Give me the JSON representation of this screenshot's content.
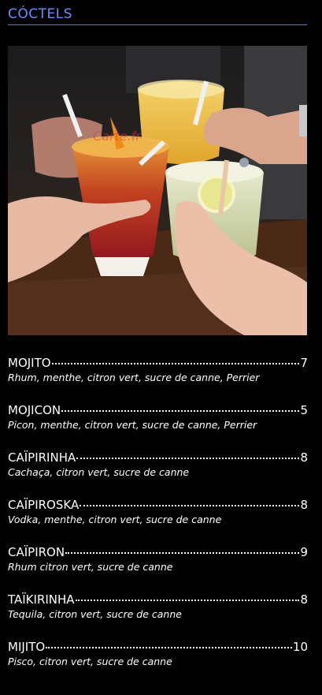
{
  "header": {
    "title": "CÓCTELS"
  },
  "photo": {
    "watermark": "Carte.fr"
  },
  "menu": {
    "items": [
      {
        "name": "MOJITO",
        "price": "7",
        "description": "Rhum, menthe, citron vert, sucre de canne, Perrier"
      },
      {
        "name": "MOJICON",
        "price": "5",
        "description": "Picon, menthe, citron vert, sucre de canne, Perrier"
      },
      {
        "name": "CAÏPIRINHA",
        "price": "8",
        "description": "Cachaça, citron vert, sucre de canne"
      },
      {
        "name": "CAÏPIROSKA",
        "price": "8",
        "description": "Vodka, menthe, citron vert, sucre de canne"
      },
      {
        "name": "CAÏPIRON",
        "price": "9",
        "description": "Rhum citron vert, sucre de canne"
      },
      {
        "name": "TAÏKIRINHA",
        "price": "8",
        "description": "Tequila, citron vert, sucre de canne"
      },
      {
        "name": "MIJITO",
        "price": "10",
        "description": "Pisco, citron vert, sucre de canne"
      }
    ]
  }
}
